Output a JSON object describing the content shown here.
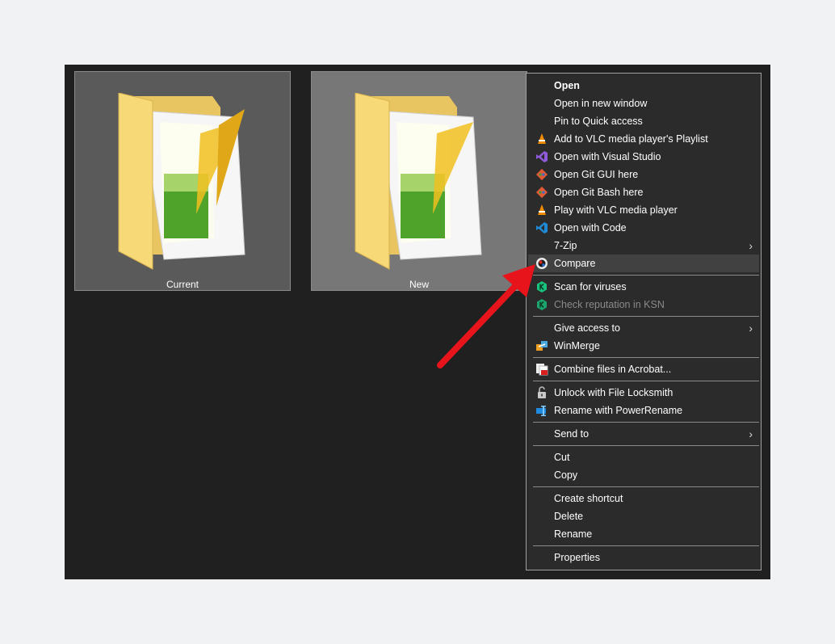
{
  "folders": [
    {
      "label": "Current"
    },
    {
      "label": "New"
    }
  ],
  "menu": {
    "items": [
      {
        "label": "Open",
        "icon": "none"
      },
      {
        "label": "Open in new window",
        "icon": "none"
      },
      {
        "label": "Pin to Quick access",
        "icon": "none"
      },
      {
        "label": "Add to VLC media player's Playlist",
        "icon": "vlc-icon"
      },
      {
        "label": "Open with Visual Studio",
        "icon": "visual-studio-icon"
      },
      {
        "label": "Open Git GUI here",
        "icon": "git-icon"
      },
      {
        "label": "Open Git Bash here",
        "icon": "git-icon"
      },
      {
        "label": "Play with VLC media player",
        "icon": "vlc-icon"
      },
      {
        "label": "Open with Code",
        "icon": "vscode-icon"
      },
      {
        "label": "7-Zip",
        "icon": "none"
      },
      {
        "label": "Compare",
        "icon": "compare-icon"
      },
      {
        "label": "Scan for viruses",
        "icon": "kaspersky-icon"
      },
      {
        "label": "Check reputation in KSN",
        "icon": "kaspersky-icon"
      },
      {
        "label": "Give access to",
        "icon": "none"
      },
      {
        "label": "WinMerge",
        "icon": "winmerge-icon"
      },
      {
        "label": "Combine files in Acrobat...",
        "icon": "acrobat-icon"
      },
      {
        "label": "Unlock with File Locksmith",
        "icon": "lock-icon"
      },
      {
        "label": "Rename with PowerRename",
        "icon": "powerrename-icon"
      },
      {
        "label": "Send to",
        "icon": "none"
      },
      {
        "label": "Cut",
        "icon": "none"
      },
      {
        "label": "Copy",
        "icon": "none"
      },
      {
        "label": "Create shortcut",
        "icon": "none"
      },
      {
        "label": "Delete",
        "icon": "none"
      },
      {
        "label": "Rename",
        "icon": "none"
      },
      {
        "label": "Properties",
        "icon": "none"
      }
    ],
    "submenu_arrow": "›",
    "highlighted": "Compare"
  },
  "annotation": {
    "color": "#e8141b",
    "points_to": "Compare"
  }
}
